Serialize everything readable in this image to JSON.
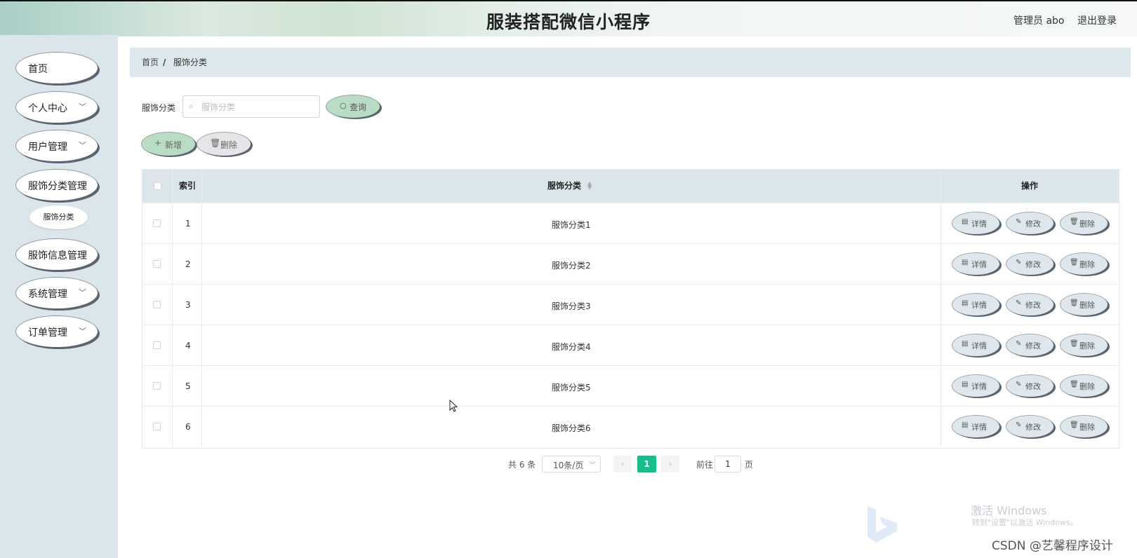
{
  "header": {
    "title": "服装搭配微信小程序",
    "admin": "管理员 abo",
    "logout": "退出登录"
  },
  "sidebar": {
    "items": [
      {
        "label": "首页",
        "has_arrow": false
      },
      {
        "label": "个人中心",
        "has_arrow": true
      },
      {
        "label": "用户管理",
        "has_arrow": true
      },
      {
        "label": "服饰分类管理",
        "has_arrow": false
      },
      {
        "label": "服饰信息管理",
        "has_arrow": false
      },
      {
        "label": "系统管理",
        "has_arrow": true
      },
      {
        "label": "订单管理",
        "has_arrow": true
      }
    ],
    "sub_item": "服饰分类"
  },
  "breadcrumb": {
    "home": "首页",
    "separator": "/",
    "current": "服饰分类"
  },
  "search": {
    "label": "服饰分类",
    "placeholder": "服饰分类",
    "value": "",
    "query_label": "查询"
  },
  "actions": {
    "add_label": "新增",
    "delete_label": "删除"
  },
  "table": {
    "columns": [
      "索引",
      "服饰分类",
      "操作"
    ],
    "rows": [
      {
        "index": "1",
        "category": "服饰分类1"
      },
      {
        "index": "2",
        "category": "服饰分类2"
      },
      {
        "index": "3",
        "category": "服饰分类3"
      },
      {
        "index": "4",
        "category": "服饰分类4"
      },
      {
        "index": "5",
        "category": "服饰分类5"
      },
      {
        "index": "6",
        "category": "服饰分类6"
      }
    ],
    "row_actions": {
      "detail": "详情",
      "edit": "修改",
      "delete": "删除"
    }
  },
  "pagination": {
    "total": "共 6 条",
    "page_size": "10条/页",
    "current_page": "1",
    "goto_prefix": "前往",
    "goto_value": "1",
    "goto_suffix": "页"
  },
  "watermark": {
    "line1": "激活 Windows",
    "line2": "转到\"设置\"以激活 Windows。",
    "csdn": "CSDN @艺馨程序设计"
  },
  "colors": {
    "sidebar_bg": "#dbe6ea",
    "breadcrumb_bg": "#dde8ec",
    "table_head_bg": "#dbe6ea",
    "primary_button": "#b9dcc4",
    "page_active": "#13c08c"
  },
  "icons": {
    "search": "search-icon",
    "plus": "plus-icon",
    "trash": "trash-icon",
    "detail": "document-icon",
    "edit": "pencil-icon",
    "chevron": "chevron-down-icon"
  }
}
